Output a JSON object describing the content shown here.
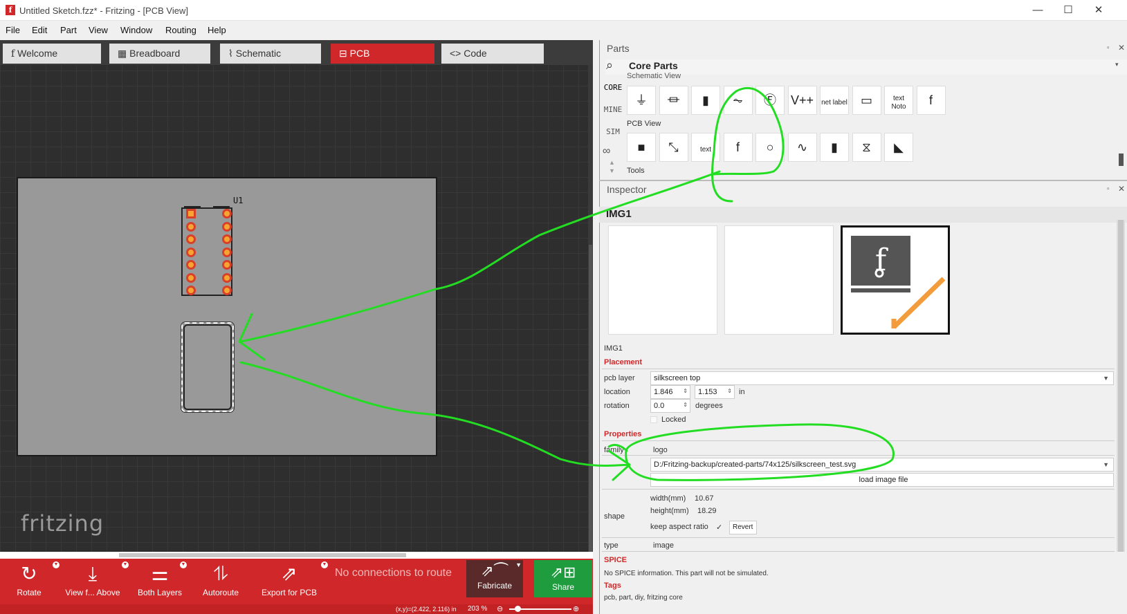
{
  "window": {
    "title": "Untitled Sketch.fzz* - Fritzing - [PCB View]",
    "minimize": "—",
    "maximize": "☐",
    "close": "✕"
  },
  "menu": [
    "File",
    "Edit",
    "Part",
    "View",
    "Window",
    "Routing",
    "Help"
  ],
  "tabs": [
    {
      "label": "Welcome",
      "icon": "f"
    },
    {
      "label": "Breadboard",
      "icon": "▦"
    },
    {
      "label": "Schematic",
      "icon": "⌇"
    },
    {
      "label": "PCB",
      "icon": "⊟"
    },
    {
      "label": "Code",
      "icon": "<>"
    }
  ],
  "canvas": {
    "part_label": "U1",
    "watermark": "fritzing"
  },
  "toolbar": {
    "rotate": "Rotate",
    "view_from_above": "View f... Above",
    "both_layers": "Both Layers",
    "autoroute": "Autoroute",
    "export": "Export for PCB",
    "routing_status": "No connections to route",
    "fabricate": "Fabricate",
    "share": "Share"
  },
  "statusbar": {
    "coords": "(x,y)=(2.422, 2.116) in",
    "zoom": "203 %"
  },
  "parts": {
    "panel_title": "Parts",
    "bin_title": "Core Parts",
    "bins": [
      "CORE",
      "MINE",
      "SIM"
    ],
    "schematic_section": "Schematic View",
    "pcb_section": "PCB View",
    "tools_section": "Tools",
    "schematic_items": [
      "⏚",
      "⏛",
      "▮",
      "⏦",
      "Ⓕ",
      "V++",
      "net label",
      "▭",
      "text Noto",
      "f"
    ],
    "pcb_items": [
      "■",
      "⤡",
      "text",
      "f",
      "○",
      "∿",
      "▮",
      "⧖",
      "◣"
    ]
  },
  "inspector": {
    "panel_title": "Inspector",
    "part_title": "IMG1",
    "part_name": "IMG1",
    "placement_hdr": "Placement",
    "pcb_layer_label": "pcb layer",
    "pcb_layer_value": "silkscreen top",
    "location_label": "location",
    "location_x": "1.846",
    "location_y": "1.153",
    "location_unit": "in",
    "rotation_label": "rotation",
    "rotation_value": "0.0",
    "rotation_unit": "degrees",
    "locked_label": "Locked",
    "properties_hdr": "Properties",
    "family_label": "family",
    "family_value": "logo",
    "image_path": "D:/Fritzing-backup/created-parts/74x125/silkscreen_test.svg",
    "load_button": "load image file",
    "shape_label": "shape",
    "width_label": "width(mm)",
    "width_value": "10.67",
    "height_label": "height(mm)",
    "height_value": "18.29",
    "aspect_label": "keep aspect ratio",
    "aspect_check": "✓",
    "revert_button": "Revert",
    "type_label": "type",
    "type_value": "image",
    "spice_hdr": "SPICE",
    "spice_text": "No SPICE information. This part will not be simulated.",
    "tags_hdr": "Tags",
    "tags_text": "pcb, part, diy, fritzing core"
  },
  "colors": {
    "accent": "#d0282a",
    "share": "#1f9d3e",
    "annotation": "#22dd22",
    "pad": "#f6a532"
  }
}
